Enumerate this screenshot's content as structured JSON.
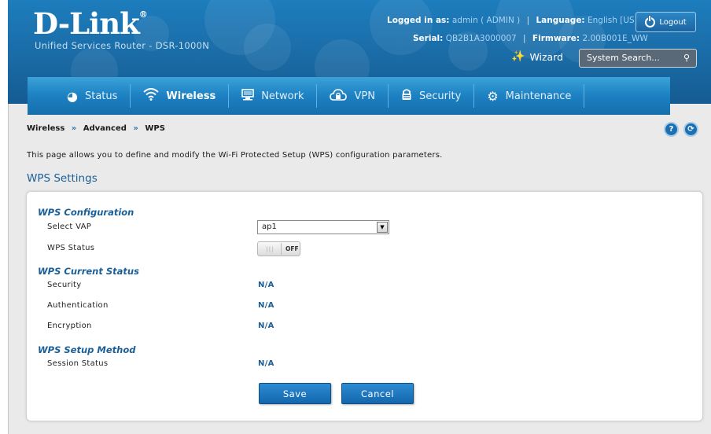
{
  "header": {
    "brand": "D-Link",
    "brand_mark": "®",
    "product": "Unified Services Router - DSR-1000N",
    "logged_in_label": "Logged in as:",
    "logged_in_value": "admin ( ADMIN )",
    "language_label": "Language:",
    "language_value": "English [US]",
    "serial_label": "Serial:",
    "serial_value": "QB2B1A3000007",
    "firmware_label": "Firmware:",
    "firmware_value": "2.00B001E_WW",
    "logout_label": "Logout",
    "wizard_label": "Wizard",
    "search_placeholder": "System Search..."
  },
  "nav": {
    "items": [
      {
        "label": "Status",
        "icon": "dashboard-icon"
      },
      {
        "label": "Wireless",
        "icon": "wifi-icon",
        "active": true
      },
      {
        "label": "Network",
        "icon": "monitor-icon"
      },
      {
        "label": "VPN",
        "icon": "cloud-lock-icon"
      },
      {
        "label": "Security",
        "icon": "lock-icon"
      },
      {
        "label": "Maintenance",
        "icon": "gears-icon"
      }
    ]
  },
  "breadcrumb": {
    "items": [
      "Wireless",
      "Advanced",
      "WPS"
    ],
    "separator": "»"
  },
  "page": {
    "description": "This page allows you to define and modify the Wi-Fi Protected Setup (WPS) configuration parameters.",
    "section_title": "WPS Settings"
  },
  "form": {
    "config_heading": "WPS Configuration",
    "select_vap_label": "Select VAP",
    "select_vap_value": "ap1",
    "wps_status_label": "WPS Status",
    "wps_status_toggle": "OFF",
    "current_status_heading": "WPS Current Status",
    "security_label": "Security",
    "security_value": "N/A",
    "authentication_label": "Authentication",
    "authentication_value": "N/A",
    "encryption_label": "Encryption",
    "encryption_value": "N/A",
    "setup_method_heading": "WPS Setup Method",
    "session_status_label": "Session Status",
    "session_status_value": "N/A",
    "save_label": "Save",
    "cancel_label": "Cancel"
  },
  "colors": {
    "header_blue": "#1a6ba6",
    "nav_blue": "#1c80c2",
    "heading_blue": "#1a5f98",
    "button_blue": "#1a76bf"
  }
}
